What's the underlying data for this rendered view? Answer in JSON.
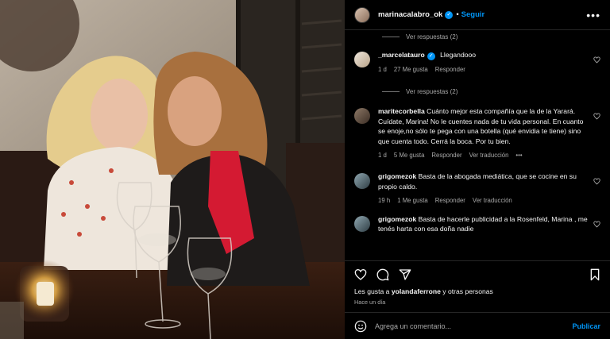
{
  "post": {
    "username": "marinacalabro_ok",
    "follow_label": "Seguir",
    "more_label": "•••"
  },
  "comments": [
    {
      "type": "replies",
      "label": "Ver respuestas (2)"
    },
    {
      "type": "comment",
      "username": "_marcelatauro",
      "verified": true,
      "text": "Llegandooo",
      "time": "1 d",
      "likes": "27 Me gusta",
      "reply": "Responder",
      "translate": ""
    },
    {
      "type": "replies",
      "label": "Ver respuestas (2)"
    },
    {
      "type": "comment",
      "username": "maritecorbella",
      "verified": false,
      "text": "Cuánto mejor esta compañía que la de la Yarará. Cuídate, Marina! No le cuentes nada de tu vida personal. En cuanto se enoje,no sólo te pega con una botella (qué envidia te tiene) sino que cuenta todo. Cerrá la boca. Por tu bien.",
      "time": "1 d",
      "likes": "5 Me gusta",
      "reply": "Responder",
      "translate": "Ver traducción"
    },
    {
      "type": "comment",
      "username": "grigomezok",
      "verified": false,
      "text": "Basta de la abogada mediática, que se cocine en su propio caldo.",
      "time": "19 h",
      "likes": "1 Me gusta",
      "reply": "Responder",
      "translate": "Ver traducción"
    },
    {
      "type": "comment",
      "username": "grigomezok",
      "verified": false,
      "text": "Basta de hacerle publicidad a la Rosenfeld, Marina , me tenés harta con esa doña nadie",
      "time": "",
      "likes": "",
      "reply": "",
      "translate": ""
    }
  ],
  "likes_line": {
    "prefix": "Les gusta a ",
    "user": "yolandaferrone",
    "suffix": " y otras personas"
  },
  "time_ago": "Hace un día",
  "comment_box": {
    "placeholder": "Agrega un comentario...",
    "publish": "Publicar"
  },
  "colors": {
    "accent": "#0095f6",
    "muted": "#a8a8a8",
    "background": "#000000"
  },
  "icons": [
    "heart-icon",
    "comment-icon",
    "share-icon",
    "bookmark-icon",
    "emoji-icon",
    "more-icon",
    "verified-icon"
  ]
}
